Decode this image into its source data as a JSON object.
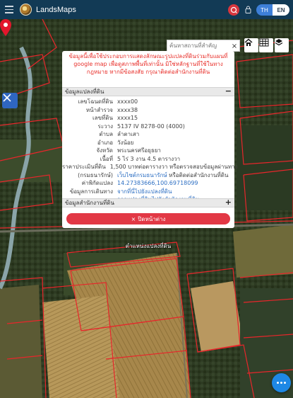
{
  "header": {
    "app_title": "LandsMaps",
    "lang_th": "TH",
    "lang_en": "EN",
    "accent": "#3d7fd8",
    "record_color": "#d8363e"
  },
  "search": {
    "placeholder": "ค้นหาสถานที่สำคัญ",
    "close_label": "×"
  },
  "popup": {
    "notice": "ข้อมูลนี้เพื่อใช้ประกอบการแสดงลักษณะรูปแปลงที่ดินร่วมกับแผนที่ google map เพื่อดูสภาพพื้นที่เท่านั้น มิใช่หลักฐานที่ใช้ในทางกฎหมาย หากมีข้อสงสัย กรุณาติดต่อสำนักงานที่ดิน",
    "section_parcel": "ข้อมูลแปลงที่ดิน",
    "section_parcel_toggle": "−",
    "section_office": "ข้อมูลสำนักงานที่ดิน",
    "section_office_toggle": "+",
    "rows": [
      {
        "k": "เลขโฉนดที่ดิน",
        "v": "xxxx00"
      },
      {
        "k": "หน้าสำรวจ",
        "v": "xxxx38"
      },
      {
        "k": "เลขที่ดิน",
        "v": "xxxx15"
      },
      {
        "k": "ระวาง",
        "v": "5137 IV 8278-00 (4000)"
      },
      {
        "k": "ตำบล",
        "v": "ลำตาเสา"
      },
      {
        "k": "อำเภอ",
        "v": "วังน้อย"
      },
      {
        "k": "จังหวัด",
        "v": "พระนครศรีอยุธยา"
      },
      {
        "k": "เนื้อที่",
        "v": "5 ไร่ 3 งาน 4.5 ตารางวา"
      },
      {
        "k": "ราคาประเมินที่ดิน",
        "v": "1,500 บาทต่อตารางวา หรือตรวจสอบข้อมูลผ่านทาง"
      },
      {
        "k": "(กรมธนารักษ์)",
        "v": "เว็บไซต์กรมธนารักษ์",
        "v2": " หรือติดต่อสำนักงานที่ดิน"
      },
      {
        "k": "ค่าพิกัดแปลง",
        "v": "14.27383666,100.69718099"
      },
      {
        "k": "ข้อมูลการเดินทาง",
        "v": "จากที่นี่ไปยังแปลงที่ดิน"
      },
      {
        "k": "",
        "v": "จากแปลงที่ดินไปยังสำนักงานที่ดิน"
      }
    ],
    "close_button": "ปิดหน้าต่าง",
    "close_icon": "×",
    "close_color": "#e23845"
  },
  "map": {
    "pin_label": "ตำแหน่งแปลงที่ดิน",
    "pin_color": "#e3162c",
    "parcel_line_color": "#e8262b"
  },
  "icons": {
    "menu": "hamburger-icon",
    "record": "record-icon",
    "lock": "lock-icon",
    "home": "home-icon",
    "grid": "grid-icon",
    "layers": "layers-icon",
    "tool": "measure-icon",
    "more": "more-icon"
  }
}
